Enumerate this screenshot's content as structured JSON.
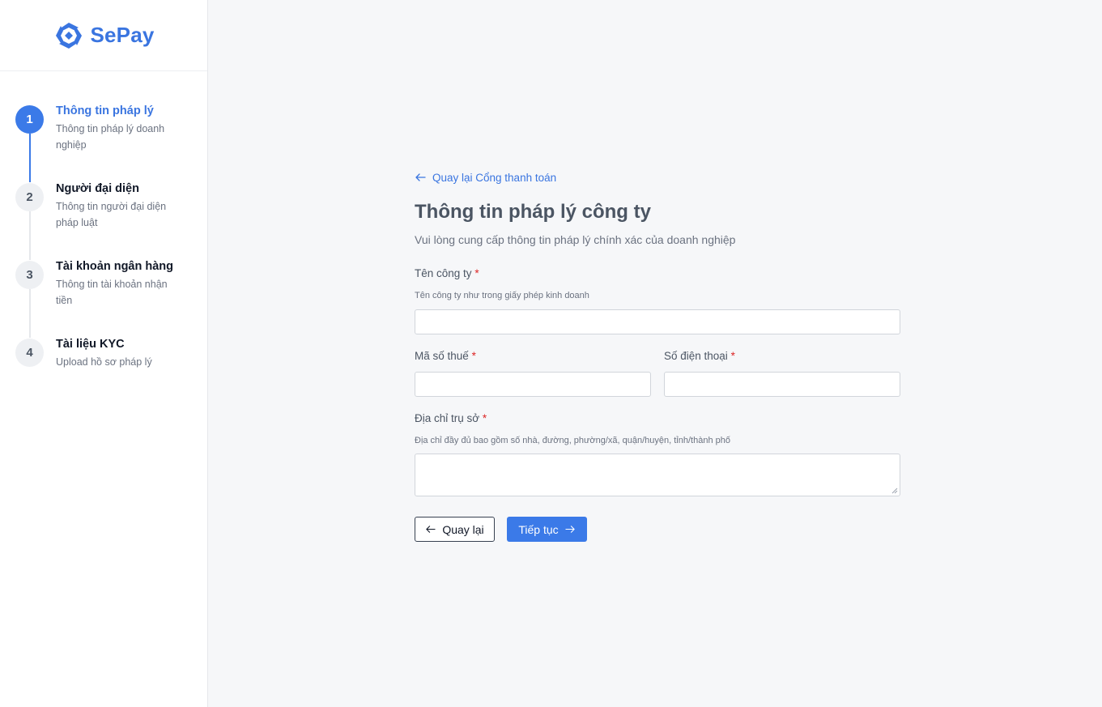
{
  "brand": {
    "name": "SePay",
    "color": "#3a75e0"
  },
  "steps": [
    {
      "number": "1",
      "title": "Thông tin pháp lý",
      "desc": "Thông tin pháp lý doanh nghiệp",
      "active": true
    },
    {
      "number": "2",
      "title": "Người đại diện",
      "desc": "Thông tin người đại diện pháp luật",
      "active": false
    },
    {
      "number": "3",
      "title": "Tài khoản ngân hàng",
      "desc": "Thông tin tài khoản nhận tiền",
      "active": false
    },
    {
      "number": "4",
      "title": "Tài liệu KYC",
      "desc": "Upload hồ sơ pháp lý",
      "active": false
    }
  ],
  "main": {
    "back_link": "Quay lại Cổng thanh toán",
    "title": "Thông tin pháp lý công ty",
    "subtitle": "Vui lòng cung cấp thông tin pháp lý chính xác của doanh nghiệp"
  },
  "form": {
    "company_name": {
      "label": "Tên công ty",
      "required": "*",
      "hint": "Tên công ty như trong giấy phép kinh doanh",
      "value": ""
    },
    "tax_code": {
      "label": "Mã số thuế",
      "required": "*",
      "value": ""
    },
    "phone": {
      "label": "Số điện thoại",
      "required": "*",
      "value": ""
    },
    "address": {
      "label": "Địa chỉ trụ sở",
      "required": "*",
      "hint": "Địa chỉ đầy đủ bao gồm số nhà, đường, phường/xã, quận/huyện, tỉnh/thành phố",
      "value": ""
    }
  },
  "buttons": {
    "back": "Quay lại",
    "next": "Tiếp tục"
  },
  "colors": {
    "accent": "#3b7ae8",
    "required": "#dc2626",
    "background": "#f6f7f9"
  }
}
